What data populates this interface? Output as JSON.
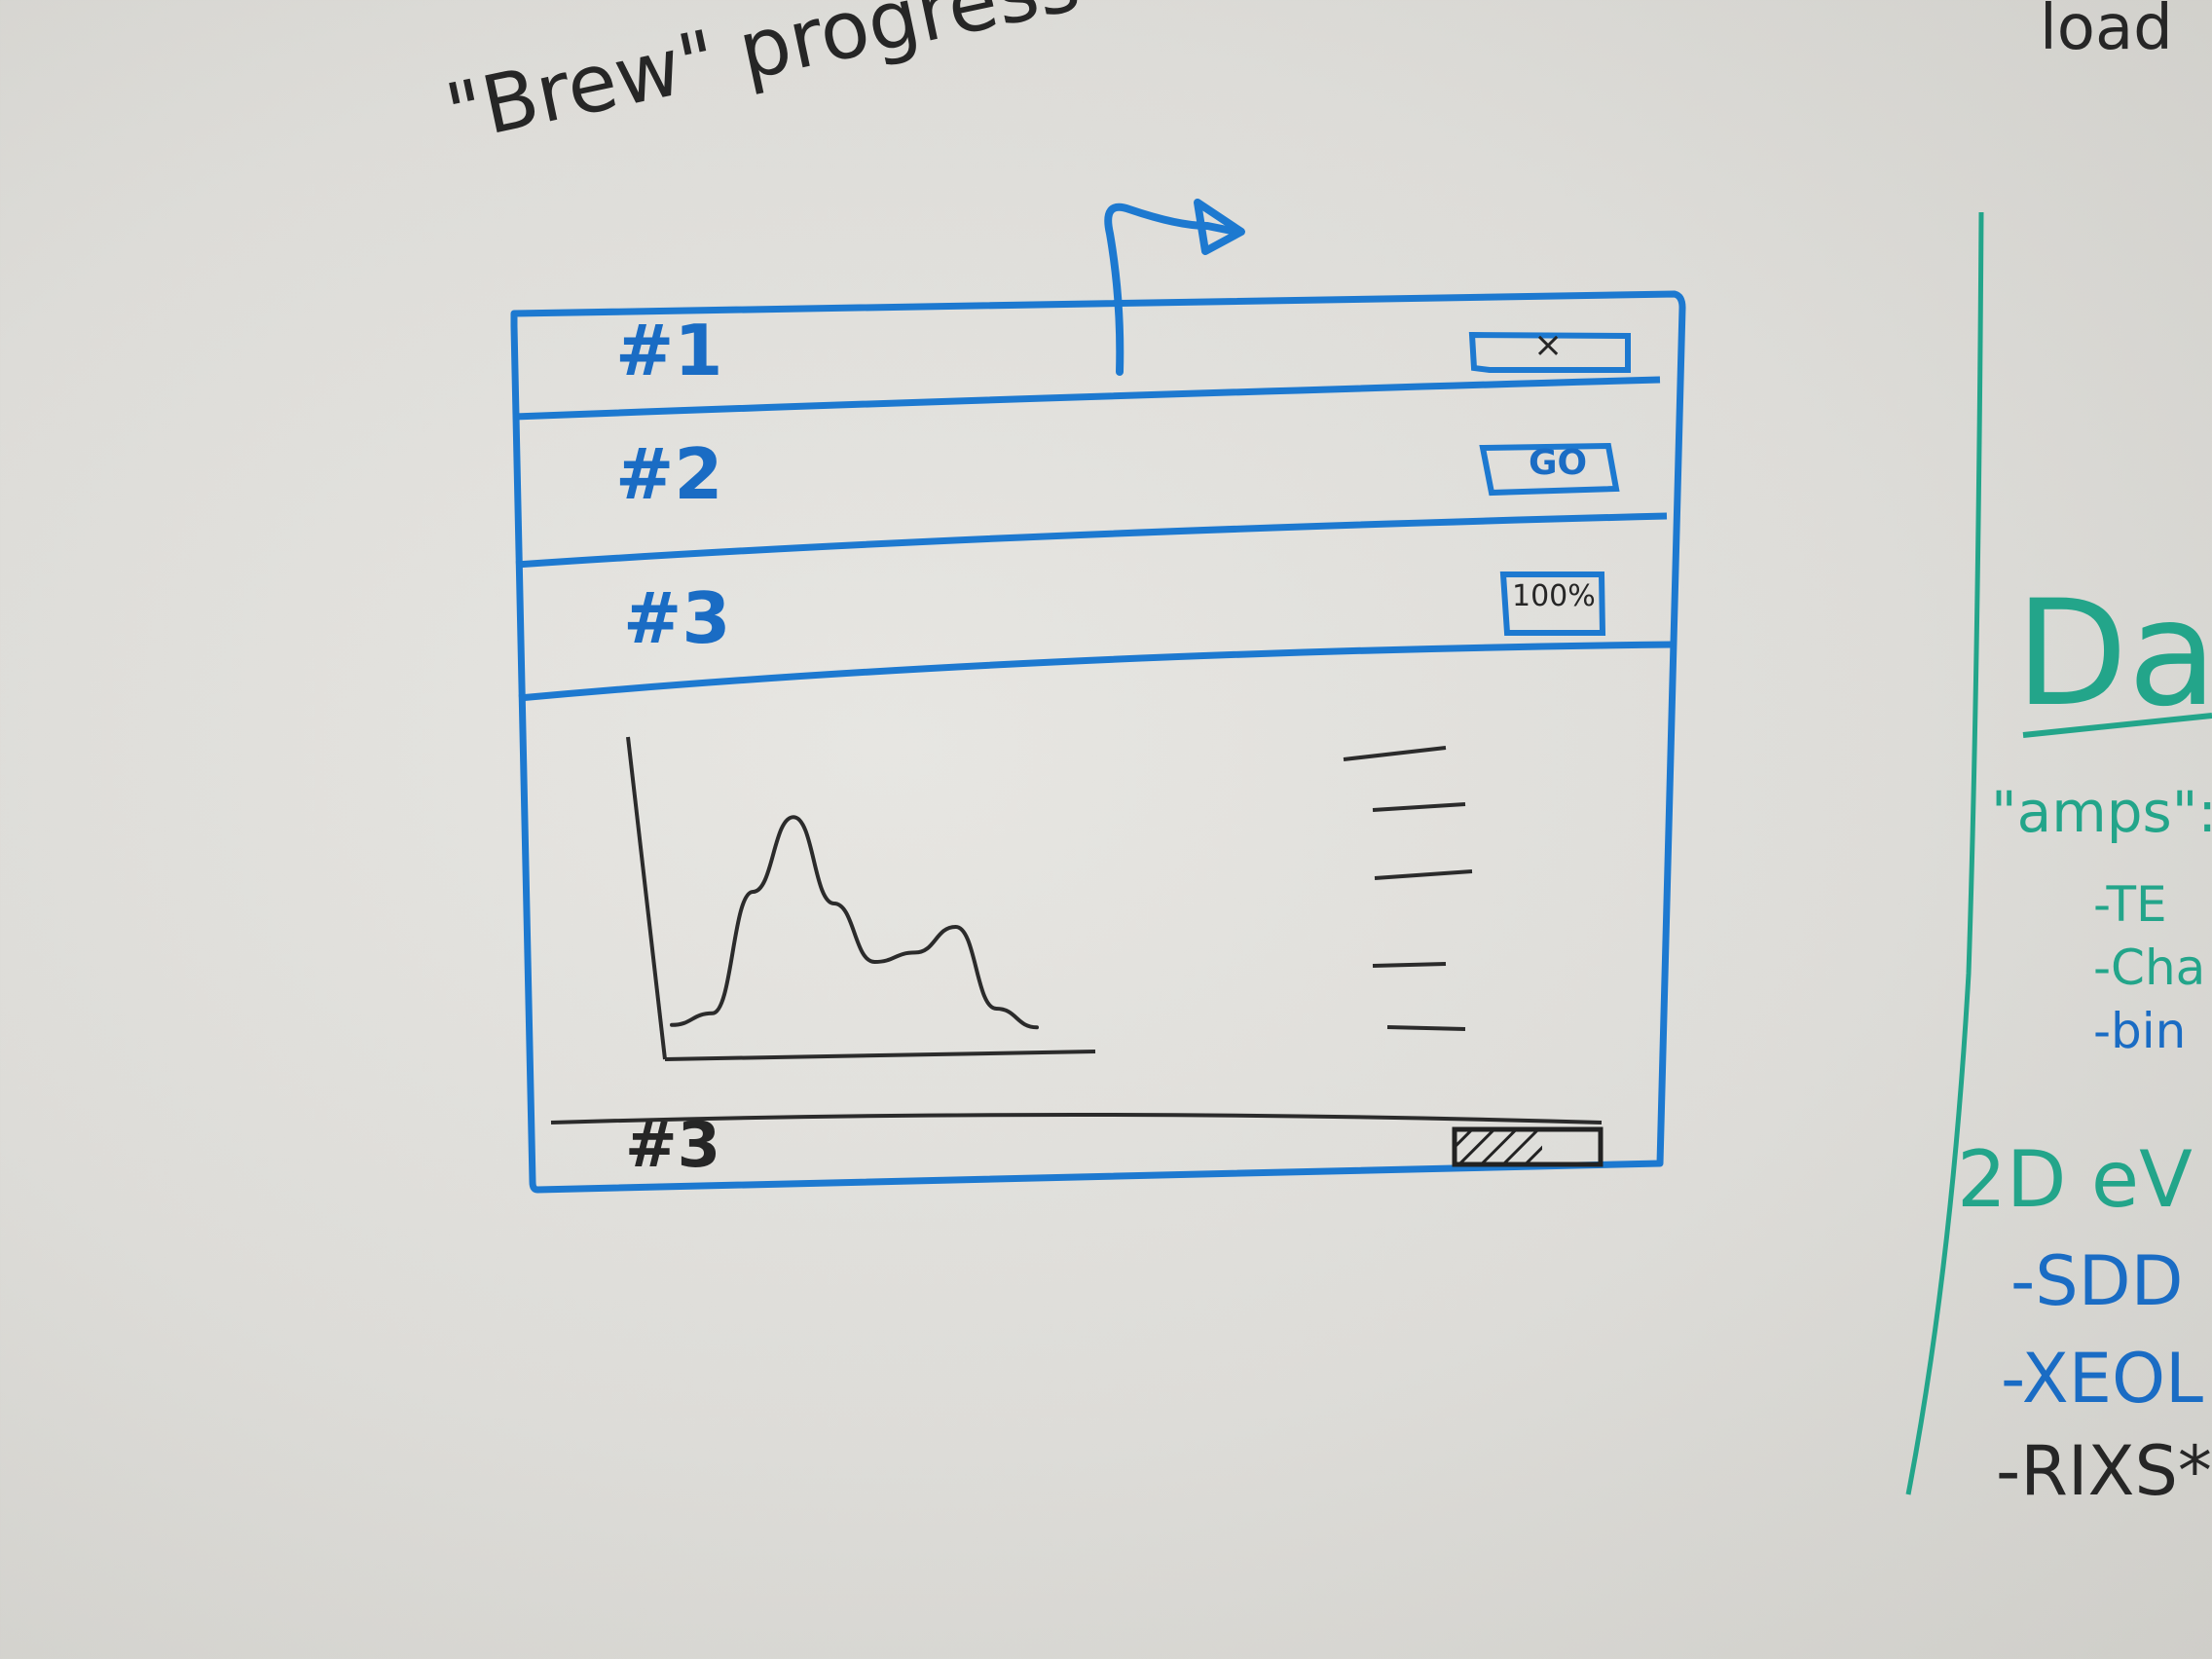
{
  "whiteboard": {
    "title_note": "\"Brew\" progress",
    "corner_note": "load"
  },
  "mockup_window": {
    "rows": [
      {
        "label": "#1",
        "status": "×",
        "status_kind": "close-button"
      },
      {
        "label": "#2",
        "status": "GO",
        "status_kind": "go-button"
      },
      {
        "label": "#3",
        "status": "100%",
        "status_kind": "progress-percent"
      }
    ],
    "footer": {
      "label": "#3",
      "progress": 0.6
    }
  },
  "chart_data": {
    "type": "line",
    "title": "",
    "xlabel": "",
    "ylabel": "",
    "series": [
      {
        "values": [
          0.03,
          0.08,
          0.6,
          0.92,
          0.55,
          0.3,
          0.34,
          0.45,
          0.1,
          0.02
        ]
      }
    ]
  },
  "side_notes": {
    "heading": "Dat",
    "amps_label": "\"amps\":",
    "amps_items": [
      "-TE",
      "-Cha",
      "-bin"
    ],
    "section_2d": "2D eV",
    "section_items": [
      "-SDD",
      "-XEOL",
      "-RIXS*"
    ]
  },
  "colors": {
    "marker_blue": "#1a6cc4",
    "marker_black": "#262626",
    "marker_teal": "#23a58a",
    "board": "#e2e1dd"
  }
}
